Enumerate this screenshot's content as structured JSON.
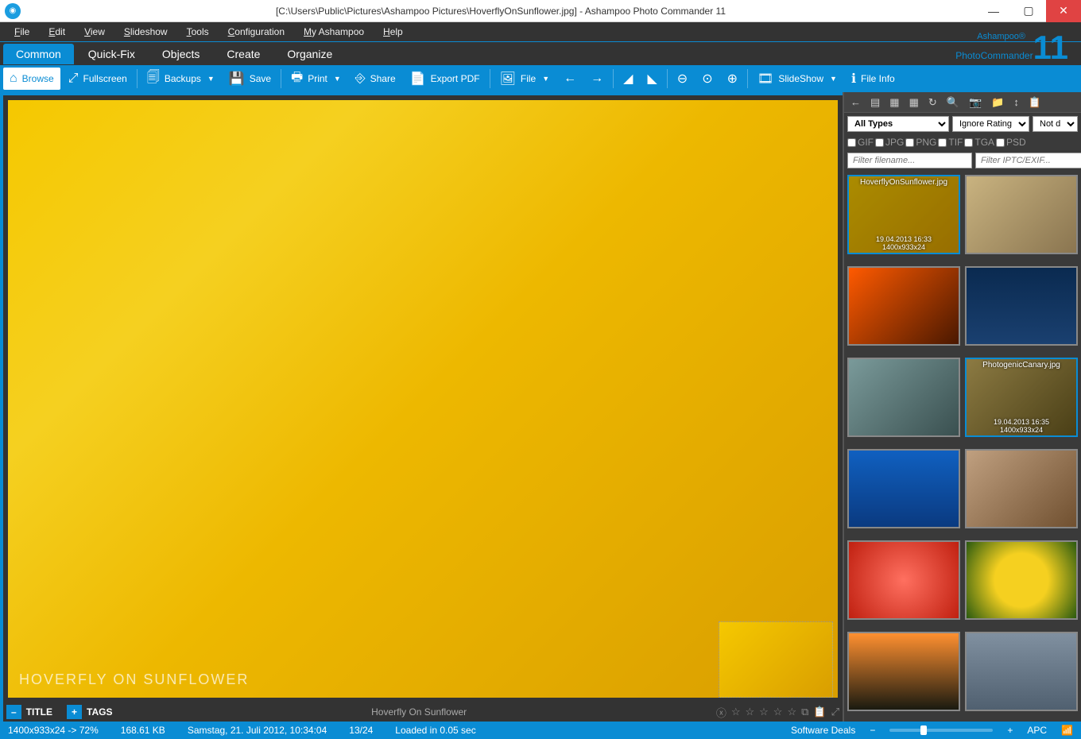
{
  "titlebar": {
    "title": "[C:\\Users\\Public\\Pictures\\Ashampoo Pictures\\HoverflyOnSunflower.jpg] - Ashampoo Photo Commander 11"
  },
  "menu": [
    "File",
    "Edit",
    "View",
    "Slideshow",
    "Tools",
    "Configuration",
    "My Ashampoo",
    "Help"
  ],
  "brand": {
    "name": "PhotoCommander",
    "ash": "Ashampoo®",
    "ver": "11"
  },
  "ribbon": {
    "tabs": [
      "Common",
      "Quick-Fix",
      "Objects",
      "Create",
      "Organize"
    ],
    "active": 0
  },
  "toolbar": {
    "browse": "Browse",
    "fullscreen": "Fullscreen",
    "backups": "Backups",
    "save": "Save",
    "print": "Print",
    "share": "Share",
    "exportpdf": "Export PDF",
    "file": "File",
    "slideshow": "SlideShow",
    "fileinfo": "File Info"
  },
  "photo": {
    "caption": "HOVERFLY ON SUNFLOWER"
  },
  "bottombar": {
    "title_label": "TITLE",
    "tags_label": "TAGS",
    "title_value": "Hoverfly On Sunflower"
  },
  "sidepanel": {
    "type_filter": "All Types",
    "rating_filter": "Ignore Rating",
    "date_filter": "Not d",
    "formats": [
      "GIF",
      "JPG",
      "PNG",
      "TIF",
      "TGA",
      "PSD"
    ],
    "search_placeholder": "Filter filename...",
    "iptc_placeholder": "Filter IPTC/EXIF...",
    "thumbs": [
      {
        "name": "HoverflyOnSunflower.jpg",
        "date": "19.04.2013 16:33",
        "dim": "1400x933x24",
        "selected": true,
        "bg": "linear-gradient(135deg,#f5c800,#d99e00)"
      },
      {
        "name": "",
        "date": "",
        "dim": "",
        "bg": "linear-gradient(135deg,#c9b380,#8a7550)"
      },
      {
        "name": "",
        "date": "",
        "dim": "",
        "bg": "linear-gradient(135deg,#ff5a00,#4a1800)"
      },
      {
        "name": "",
        "date": "",
        "dim": "",
        "bg": "linear-gradient(180deg,#0a2a50,#1a4070)"
      },
      {
        "name": "",
        "date": "",
        "dim": "",
        "bg": "linear-gradient(135deg,#7a9a9a,#3a5050)"
      },
      {
        "name": "PhotogenicCanary.jpg",
        "date": "19.04.2013 16:35",
        "dim": "1400x933x24",
        "selected": true,
        "bg": "linear-gradient(135deg,#c9b060,#6a5a20)"
      },
      {
        "name": "",
        "date": "",
        "dim": "",
        "bg": "linear-gradient(180deg,#1060c0,#0a3a80)"
      },
      {
        "name": "",
        "date": "",
        "dim": "",
        "bg": "linear-gradient(135deg,#c0a080,#705030)"
      },
      {
        "name": "",
        "date": "",
        "dim": "",
        "bg": "radial-gradient(circle,#ff7060,#c02010)"
      },
      {
        "name": "",
        "date": "",
        "dim": "",
        "bg": "radial-gradient(circle,#f5d020 40%,#2a5a10)"
      },
      {
        "name": "",
        "date": "",
        "dim": "",
        "bg": "linear-gradient(180deg,#ff9030,#1a1a10)"
      },
      {
        "name": "",
        "date": "",
        "dim": "",
        "bg": "linear-gradient(180deg,#8090a0,#506070)"
      }
    ]
  },
  "statusbar": {
    "dims": "1400x933x24 -> 72%",
    "size": "168.61 KB",
    "date": "Samstag, 21. Juli 2012, 10:34:04",
    "index": "13/24",
    "loaded": "Loaded in 0.05 sec",
    "deals": "Software Deals",
    "apc": "APC"
  }
}
